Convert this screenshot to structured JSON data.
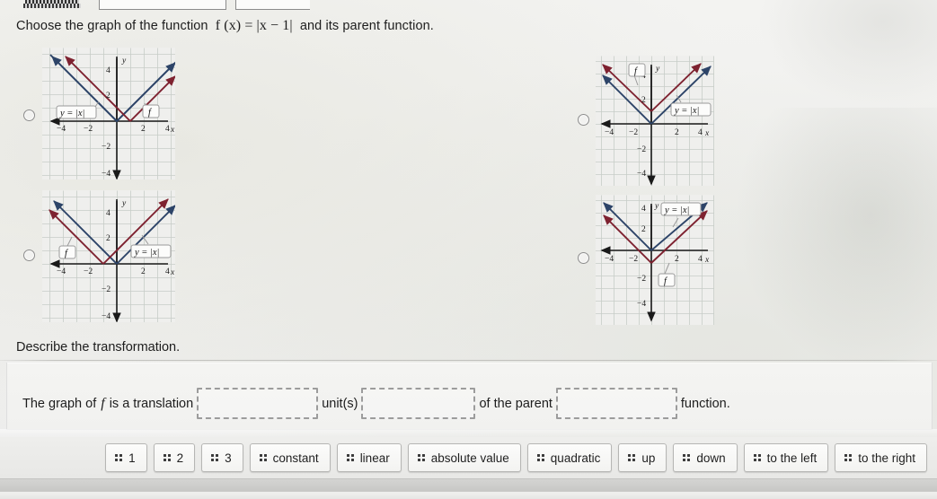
{
  "prompt": {
    "text_before": "Choose the graph of the function",
    "function_label": "f (x) = |x − 1|",
    "text_after": "and its parent function."
  },
  "describe": {
    "heading": "Describe the transformation.",
    "sentence_1": "The graph of",
    "sentence_f": "f",
    "sentence_2": "is a translation",
    "unit_label": "unit(s)",
    "sentence_3": "of the parent",
    "sentence_4": "function.",
    "blank_1_value": "",
    "blank_2_value": "",
    "blank_3_value": ""
  },
  "choices": [
    {
      "id": "choice-a",
      "selected": false,
      "axis_labels": {
        "x": "x",
        "y": "y",
        "ticks_x": [
          "−4",
          "−2",
          "2",
          "4"
        ],
        "ticks_y": [
          "4",
          "2",
          "−2",
          "−4"
        ]
      },
      "callouts": [
        {
          "text": "y = |x|",
          "for": "parent"
        },
        {
          "text": "f",
          "for": "transformed"
        }
      ],
      "parent_vertex": [
        0,
        0
      ],
      "transformed_vertex": [
        1,
        0
      ]
    },
    {
      "id": "choice-b",
      "selected": false,
      "axis_labels": {
        "x": "x",
        "y": "y",
        "ticks_x": [
          "−4",
          "−2",
          "2",
          "4"
        ],
        "ticks_y": [
          "4",
          "2",
          "−2",
          "−4"
        ]
      },
      "callouts": [
        {
          "text": "f",
          "for": "transformed"
        },
        {
          "text": "y = |x|",
          "for": "parent"
        }
      ],
      "parent_vertex": [
        0,
        0
      ],
      "transformed_vertex": [
        0,
        1
      ]
    },
    {
      "id": "choice-c",
      "selected": false,
      "axis_labels": {
        "x": "x",
        "y": "y",
        "ticks_x": [
          "−4",
          "−2",
          "2",
          "4"
        ],
        "ticks_y": [
          "4",
          "2",
          "−2",
          "−4"
        ]
      },
      "callouts": [
        {
          "text": "f",
          "for": "transformed"
        },
        {
          "text": "y = |x|",
          "for": "parent"
        }
      ],
      "parent_vertex": [
        0,
        0
      ],
      "transformed_vertex": [
        -1,
        0
      ]
    },
    {
      "id": "choice-d",
      "selected": false,
      "axis_labels": {
        "x": "x",
        "y": "y",
        "ticks_x": [
          "−4",
          "−2",
          "2",
          "4"
        ],
        "ticks_y": [
          "4",
          "2",
          "−2",
          "−4"
        ]
      },
      "callouts": [
        {
          "text": "y = |x|",
          "for": "parent"
        },
        {
          "text": "f",
          "for": "transformed"
        }
      ],
      "parent_vertex": [
        0,
        0
      ],
      "transformed_vertex": [
        0,
        -1
      ]
    }
  ],
  "tiles": [
    {
      "label": "1"
    },
    {
      "label": "2"
    },
    {
      "label": "3"
    },
    {
      "label": "constant"
    },
    {
      "label": "linear"
    },
    {
      "label": "absolute value"
    },
    {
      "label": "quadratic"
    },
    {
      "label": "up"
    },
    {
      "label": "down"
    },
    {
      "label": "to the left"
    },
    {
      "label": "to the right"
    }
  ],
  "colors": {
    "parent_curve": "#2d4468",
    "transformed_curve": "#7e2230",
    "grid": "#c9cfc9",
    "axis": "#1a1a1a",
    "page_bg": "#f1f1ef",
    "tray_bg": "#ebebe9"
  },
  "chart_data": [
    {
      "type": "line",
      "id": "choice-a",
      "title": "",
      "xlabel": "x",
      "ylabel": "y",
      "xlim": [
        -5,
        5
      ],
      "ylim": [
        -5,
        5
      ],
      "grid": true,
      "series": [
        {
          "name": "y = |x|",
          "color": "#2d4468",
          "x": [
            -5,
            0,
            5
          ],
          "values": [
            5,
            0,
            5
          ]
        },
        {
          "name": "f",
          "color": "#7e2230",
          "x": [
            -4,
            1,
            5
          ],
          "values": [
            5,
            0,
            4
          ]
        }
      ]
    },
    {
      "type": "line",
      "id": "choice-b",
      "title": "",
      "xlabel": "x",
      "ylabel": "y",
      "xlim": [
        -5,
        5
      ],
      "ylim": [
        -5,
        5
      ],
      "grid": true,
      "series": [
        {
          "name": "y = |x|",
          "color": "#2d4468",
          "x": [
            -5,
            0,
            5
          ],
          "values": [
            5,
            0,
            5
          ]
        },
        {
          "name": "f",
          "color": "#7e2230",
          "x": [
            -4,
            0,
            4
          ],
          "values": [
            5,
            1,
            5
          ]
        }
      ]
    },
    {
      "type": "line",
      "id": "choice-c",
      "title": "",
      "xlabel": "x",
      "ylabel": "y",
      "xlim": [
        -5,
        5
      ],
      "ylim": [
        -5,
        5
      ],
      "grid": true,
      "series": [
        {
          "name": "y = |x|",
          "color": "#2d4468",
          "x": [
            -5,
            0,
            5
          ],
          "values": [
            5,
            0,
            5
          ]
        },
        {
          "name": "f",
          "color": "#7e2230",
          "x": [
            -5,
            -1,
            4
          ],
          "values": [
            4,
            0,
            5
          ]
        }
      ]
    },
    {
      "type": "line",
      "id": "choice-d",
      "title": "",
      "xlabel": "x",
      "ylabel": "y",
      "xlim": [
        -5,
        5
      ],
      "ylim": [
        -5,
        5
      ],
      "grid": true,
      "series": [
        {
          "name": "y = |x|",
          "color": "#2d4468",
          "x": [
            -5,
            0,
            5
          ],
          "values": [
            5,
            0,
            5
          ]
        },
        {
          "name": "f",
          "color": "#7e2230",
          "x": [
            -4,
            0,
            4
          ],
          "values": [
            3,
            -1,
            3
          ]
        }
      ]
    }
  ]
}
